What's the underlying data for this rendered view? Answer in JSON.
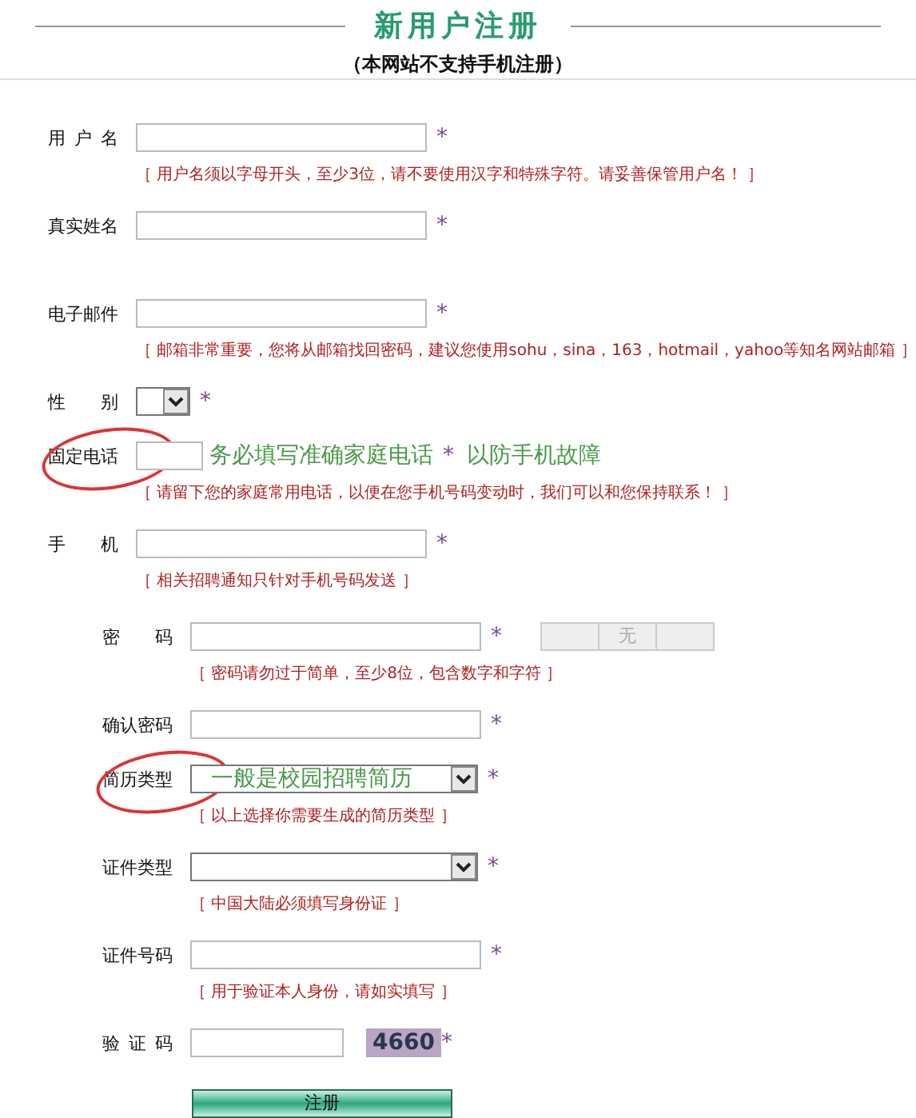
{
  "header": {
    "title": "新用户注册",
    "subtitle": "（本网站不支持手机注册）"
  },
  "sections": [
    {
      "rows": [
        {
          "kind": "text",
          "label": "用户名",
          "required_mark": "*",
          "hint": "［ 用户名须以字母开头，至少3位，请不要使用汉字和特殊字符。请妥善保管用户名！ ］"
        },
        {
          "kind": "text",
          "label": "真实姓名",
          "required_mark": "*"
        },
        {
          "kind": "text",
          "label": "电子邮件",
          "required_mark": "*",
          "hint": "［ 邮箱非常重要，您将从邮箱找回密码，建议您使用sohu，sina，163，hotmail，yahoo等知名网站邮箱 ］"
        },
        {
          "kind": "small-select",
          "label": "性别",
          "required_mark": "*"
        },
        {
          "kind": "text",
          "label": "固定电话",
          "required_mark": "*",
          "circled": true,
          "notes": [
            "务必填写准确家庭电话",
            "以防手机故障"
          ],
          "hint": "［ 请留下您的家庭常用电话，以便在您手机号码变动时，我们可以和您保持联系！ ］"
        },
        {
          "kind": "text",
          "label": "手机",
          "required_mark": "*",
          "hint": "［ 相关招聘通知只针对手机号码发送 ］"
        }
      ]
    },
    {
      "rows": [
        {
          "kind": "password",
          "label": "密码",
          "required_mark": "*",
          "strength_label": "无",
          "hint": "［ 密码请勿过于简单，至少8位，包含数字和字符 ］"
        },
        {
          "kind": "text",
          "label": "确认密码",
          "required_mark": "*"
        },
        {
          "kind": "select",
          "label": "简历类型",
          "required_mark": "*",
          "circled": true,
          "notes": [
            "一般是校园招聘简历"
          ],
          "hint": "［ 以上选择你需要生成的简历类型 ］"
        },
        {
          "kind": "select",
          "label": "证件类型",
          "required_mark": "*",
          "hint": "［ 中国大陆必须填写身份证 ］"
        },
        {
          "kind": "text",
          "label": "证件号码",
          "required_mark": "*",
          "hint": "［ 用于验证本人身份，请如实填写 ］"
        },
        {
          "kind": "captcha",
          "label": "验证码",
          "required_mark": "*",
          "captcha": "4660"
        }
      ]
    }
  ],
  "submit": "注册"
}
